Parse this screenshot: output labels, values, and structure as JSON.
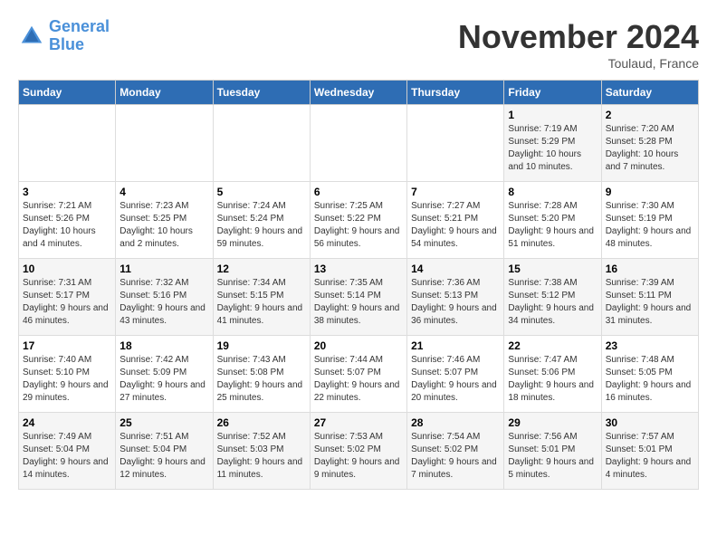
{
  "header": {
    "logo_line1": "General",
    "logo_line2": "Blue",
    "month": "November 2024",
    "location": "Toulaud, France"
  },
  "weekdays": [
    "Sunday",
    "Monday",
    "Tuesday",
    "Wednesday",
    "Thursday",
    "Friday",
    "Saturday"
  ],
  "weeks": [
    [
      {
        "day": "",
        "info": ""
      },
      {
        "day": "",
        "info": ""
      },
      {
        "day": "",
        "info": ""
      },
      {
        "day": "",
        "info": ""
      },
      {
        "day": "",
        "info": ""
      },
      {
        "day": "1",
        "info": "Sunrise: 7:19 AM\nSunset: 5:29 PM\nDaylight: 10 hours and 10 minutes."
      },
      {
        "day": "2",
        "info": "Sunrise: 7:20 AM\nSunset: 5:28 PM\nDaylight: 10 hours and 7 minutes."
      }
    ],
    [
      {
        "day": "3",
        "info": "Sunrise: 7:21 AM\nSunset: 5:26 PM\nDaylight: 10 hours and 4 minutes."
      },
      {
        "day": "4",
        "info": "Sunrise: 7:23 AM\nSunset: 5:25 PM\nDaylight: 10 hours and 2 minutes."
      },
      {
        "day": "5",
        "info": "Sunrise: 7:24 AM\nSunset: 5:24 PM\nDaylight: 9 hours and 59 minutes."
      },
      {
        "day": "6",
        "info": "Sunrise: 7:25 AM\nSunset: 5:22 PM\nDaylight: 9 hours and 56 minutes."
      },
      {
        "day": "7",
        "info": "Sunrise: 7:27 AM\nSunset: 5:21 PM\nDaylight: 9 hours and 54 minutes."
      },
      {
        "day": "8",
        "info": "Sunrise: 7:28 AM\nSunset: 5:20 PM\nDaylight: 9 hours and 51 minutes."
      },
      {
        "day": "9",
        "info": "Sunrise: 7:30 AM\nSunset: 5:19 PM\nDaylight: 9 hours and 48 minutes."
      }
    ],
    [
      {
        "day": "10",
        "info": "Sunrise: 7:31 AM\nSunset: 5:17 PM\nDaylight: 9 hours and 46 minutes."
      },
      {
        "day": "11",
        "info": "Sunrise: 7:32 AM\nSunset: 5:16 PM\nDaylight: 9 hours and 43 minutes."
      },
      {
        "day": "12",
        "info": "Sunrise: 7:34 AM\nSunset: 5:15 PM\nDaylight: 9 hours and 41 minutes."
      },
      {
        "day": "13",
        "info": "Sunrise: 7:35 AM\nSunset: 5:14 PM\nDaylight: 9 hours and 38 minutes."
      },
      {
        "day": "14",
        "info": "Sunrise: 7:36 AM\nSunset: 5:13 PM\nDaylight: 9 hours and 36 minutes."
      },
      {
        "day": "15",
        "info": "Sunrise: 7:38 AM\nSunset: 5:12 PM\nDaylight: 9 hours and 34 minutes."
      },
      {
        "day": "16",
        "info": "Sunrise: 7:39 AM\nSunset: 5:11 PM\nDaylight: 9 hours and 31 minutes."
      }
    ],
    [
      {
        "day": "17",
        "info": "Sunrise: 7:40 AM\nSunset: 5:10 PM\nDaylight: 9 hours and 29 minutes."
      },
      {
        "day": "18",
        "info": "Sunrise: 7:42 AM\nSunset: 5:09 PM\nDaylight: 9 hours and 27 minutes."
      },
      {
        "day": "19",
        "info": "Sunrise: 7:43 AM\nSunset: 5:08 PM\nDaylight: 9 hours and 25 minutes."
      },
      {
        "day": "20",
        "info": "Sunrise: 7:44 AM\nSunset: 5:07 PM\nDaylight: 9 hours and 22 minutes."
      },
      {
        "day": "21",
        "info": "Sunrise: 7:46 AM\nSunset: 5:07 PM\nDaylight: 9 hours and 20 minutes."
      },
      {
        "day": "22",
        "info": "Sunrise: 7:47 AM\nSunset: 5:06 PM\nDaylight: 9 hours and 18 minutes."
      },
      {
        "day": "23",
        "info": "Sunrise: 7:48 AM\nSunset: 5:05 PM\nDaylight: 9 hours and 16 minutes."
      }
    ],
    [
      {
        "day": "24",
        "info": "Sunrise: 7:49 AM\nSunset: 5:04 PM\nDaylight: 9 hours and 14 minutes."
      },
      {
        "day": "25",
        "info": "Sunrise: 7:51 AM\nSunset: 5:04 PM\nDaylight: 9 hours and 12 minutes."
      },
      {
        "day": "26",
        "info": "Sunrise: 7:52 AM\nSunset: 5:03 PM\nDaylight: 9 hours and 11 minutes."
      },
      {
        "day": "27",
        "info": "Sunrise: 7:53 AM\nSunset: 5:02 PM\nDaylight: 9 hours and 9 minutes."
      },
      {
        "day": "28",
        "info": "Sunrise: 7:54 AM\nSunset: 5:02 PM\nDaylight: 9 hours and 7 minutes."
      },
      {
        "day": "29",
        "info": "Sunrise: 7:56 AM\nSunset: 5:01 PM\nDaylight: 9 hours and 5 minutes."
      },
      {
        "day": "30",
        "info": "Sunrise: 7:57 AM\nSunset: 5:01 PM\nDaylight: 9 hours and 4 minutes."
      }
    ]
  ]
}
